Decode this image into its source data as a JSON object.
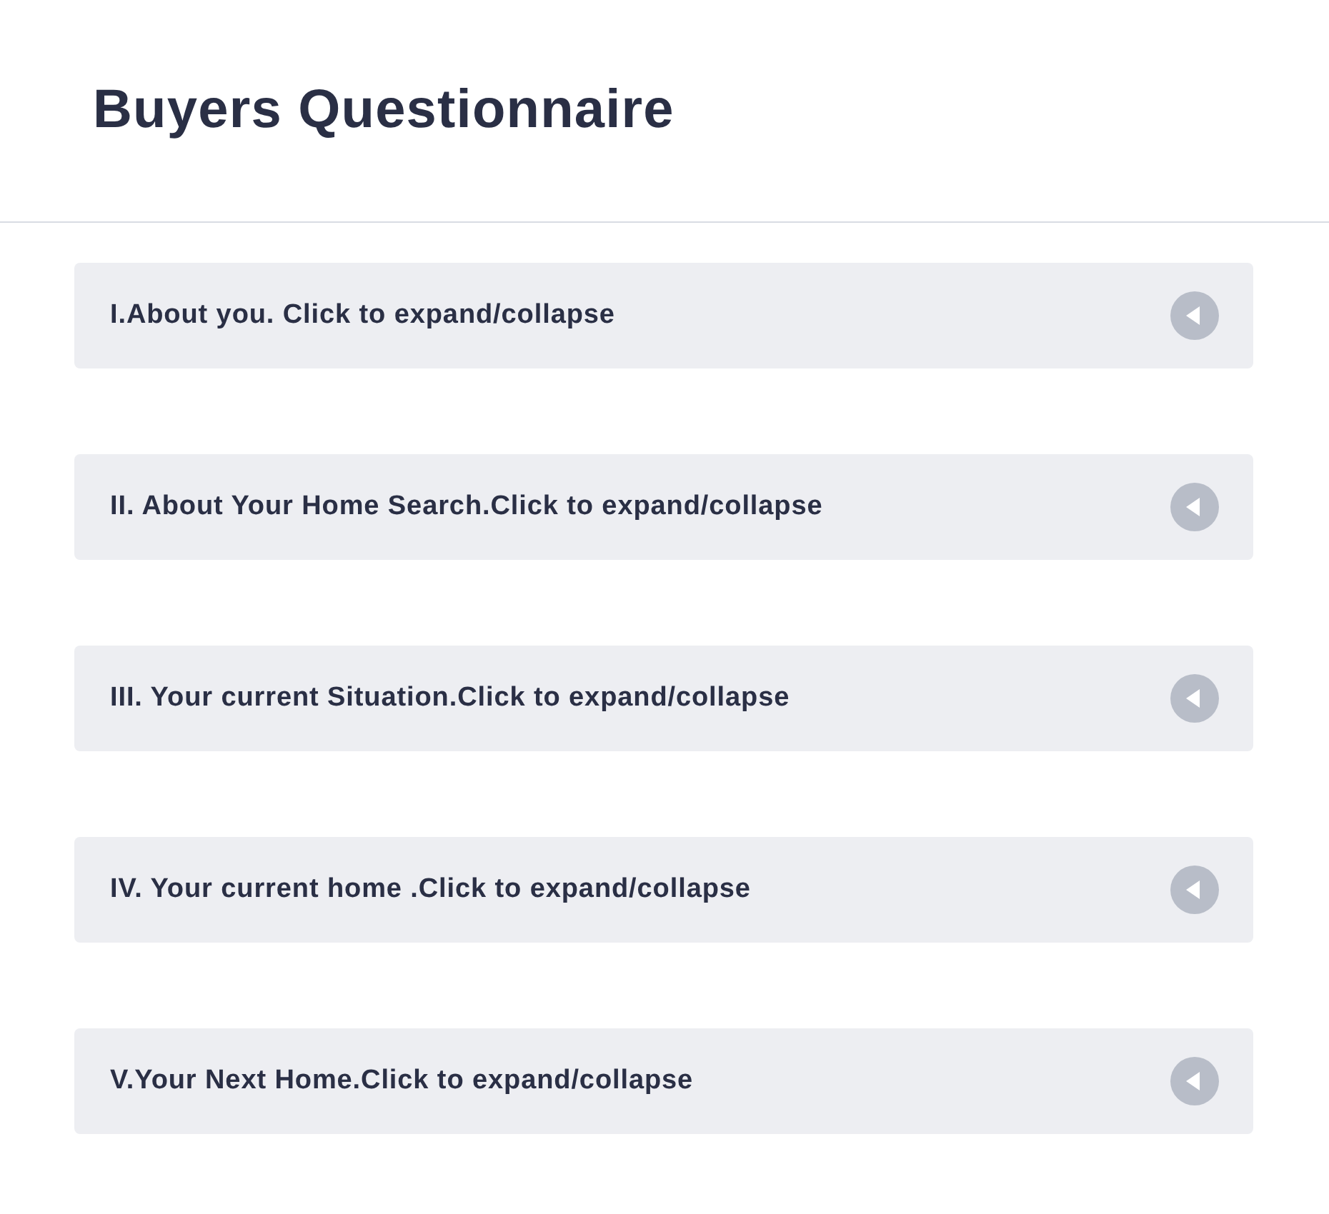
{
  "header": {
    "title": "Buyers Questionnaire"
  },
  "sections": [
    {
      "label": "I.About you. Click to expand/collapse",
      "expanded": false
    },
    {
      "label": "II. About Your Home Search.Click to expand/collapse",
      "expanded": false
    },
    {
      "label": "III. Your current Situation.Click to expand/collapse",
      "expanded": false
    },
    {
      "label": "IV. Your current home .Click to expand/collapse",
      "expanded": false
    },
    {
      "label": "V.Your Next Home.Click to expand/collapse",
      "expanded": false
    }
  ]
}
